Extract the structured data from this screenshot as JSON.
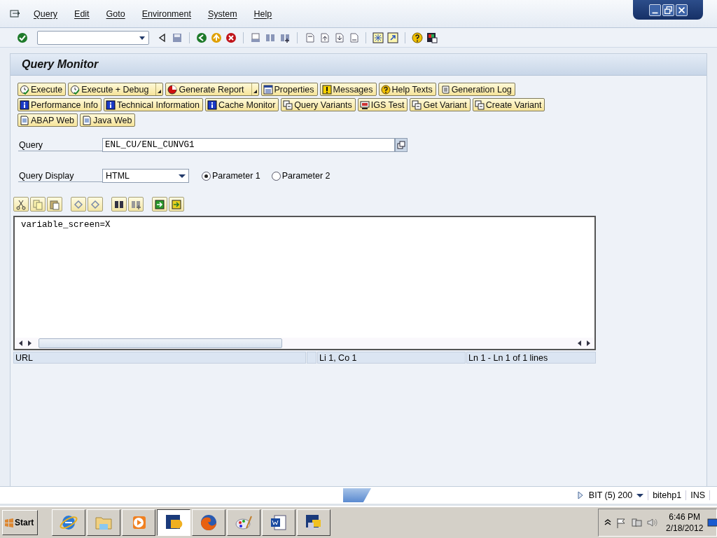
{
  "menu_bar": {
    "items": [
      "Query",
      "Edit",
      "Goto",
      "Environment",
      "System",
      "Help"
    ]
  },
  "title": "Query Monitor",
  "action_rows": [
    {
      "buttons": [
        {
          "label": "Execute",
          "kind": "execute",
          "dropdown": false
        },
        {
          "label": "Execute + Debug",
          "kind": "execute",
          "dropdown": true
        },
        {
          "label": "Generate Report",
          "kind": "report",
          "dropdown": true
        },
        {
          "label": "Properties",
          "kind": "properties",
          "dropdown": false
        },
        {
          "label": "Messages",
          "kind": "messages",
          "dropdown": false
        },
        {
          "label": "Help Texts",
          "kind": "help",
          "dropdown": false
        },
        {
          "label": "Generation Log",
          "kind": "log",
          "dropdown": false
        }
      ]
    },
    {
      "buttons": [
        {
          "label": "Performance Info",
          "kind": "info",
          "dropdown": false
        },
        {
          "label": "Technical Information",
          "kind": "info",
          "dropdown": false
        },
        {
          "label": "Cache Monitor",
          "kind": "info",
          "dropdown": false
        },
        {
          "label": "Query Variants",
          "kind": "variant",
          "dropdown": false
        },
        {
          "label": "IGS Test",
          "kind": "igs",
          "dropdown": false
        },
        {
          "label": "Get Variant",
          "kind": "variant",
          "dropdown": false
        },
        {
          "label": "Create Variant",
          "kind": "variant",
          "dropdown": false
        }
      ]
    },
    {
      "buttons": [
        {
          "label": "ABAP Web",
          "kind": "document",
          "dropdown": false
        },
        {
          "label": "Java Web",
          "kind": "document",
          "dropdown": false
        }
      ]
    }
  ],
  "form": {
    "query": {
      "label": "Query",
      "value": "ENL_CU/ENL_CUNVG1"
    },
    "display": {
      "label": "Query Display",
      "value": "HTML"
    },
    "radios": [
      {
        "label": "Parameter 1",
        "selected": true
      },
      {
        "label": "Parameter 2",
        "selected": false
      }
    ]
  },
  "editor": {
    "lines": [
      "variable_screen=X"
    ]
  },
  "editor_status": [
    "URL",
    "Li 1, Co 1",
    "Ln 1 - Ln 1 of 1 lines"
  ],
  "status_bar": {
    "system": "BIT (5) 200",
    "server": "bitehp1",
    "mode": "INS"
  },
  "taskbar": {
    "start": "Start",
    "apps": [
      {
        "kind": "browser",
        "selected": false
      },
      {
        "kind": "folder",
        "selected": false
      },
      {
        "kind": "media",
        "selected": false
      },
      {
        "kind": "logon",
        "selected": true
      },
      {
        "kind": "firefox",
        "selected": false
      },
      {
        "kind": "paint",
        "selected": false
      },
      {
        "kind": "word",
        "selected": false
      },
      {
        "kind": "gui",
        "selected": false
      }
    ],
    "time": "6:46 PM",
    "date": "2/18/2012"
  }
}
